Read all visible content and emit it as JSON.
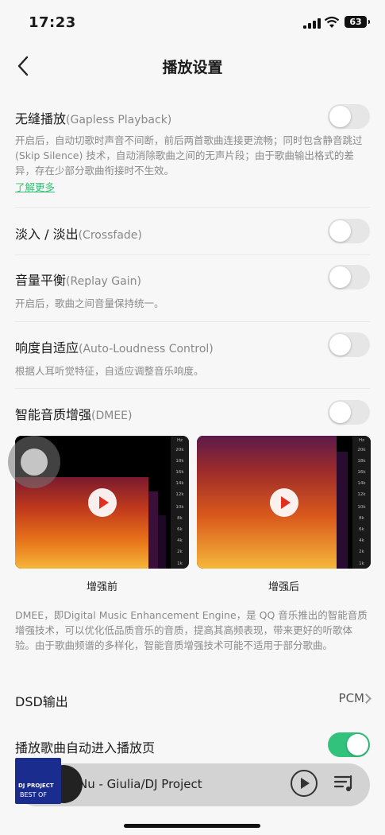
{
  "status": {
    "time": "17:23",
    "battery": "63"
  },
  "nav": {
    "title": "播放设置"
  },
  "settings": [
    {
      "title": "无缝播放",
      "en": "(Gapless Playback)",
      "desc": "开启后，自动切歌时声音不间断，前后两首歌曲连接更流畅；同时包含静音跳过 (Skip Silence) 技术，自动消除歌曲之间的无声片段；由于歌曲输出格式的差异，存在少部分歌曲衔接时不生效。",
      "link": "了解更多",
      "on": false
    },
    {
      "title": "淡入 / 淡出",
      "en": "(Crossfade)",
      "on": false
    },
    {
      "title": "音量平衡",
      "en": "(Replay Gain)",
      "desc": "开启后，歌曲之间音量保持统一。",
      "on": false
    },
    {
      "title": "响度自适应",
      "en": "(Auto-Loudness Control)",
      "desc": "根据人耳听觉特征，自适应调整音乐响度。",
      "on": false
    },
    {
      "title": "智能音质增强",
      "en": "(DMEE)",
      "on": false
    }
  ],
  "dmee": {
    "before_label": "增强前",
    "after_label": "增强后",
    "freq_ticks": [
      "Hz",
      "20k",
      "18k",
      "16k",
      "14k",
      "12k",
      "10k",
      "8k",
      "6k",
      "4k",
      "2k",
      "1k"
    ],
    "desc": "DMEE，即Digital Music Enhancement Engine，是 QQ 音乐推出的智能音质增强技术，可以优化低品质音乐的音质，提高其高频表现，带来更好的听歌体验。由于歌曲频谱的多样化，智能音质增强技术可能不适用于部分歌曲。"
  },
  "dsd": {
    "title": "DSD输出",
    "value": "PCM"
  },
  "autoplay": {
    "title": "播放歌曲自动进入播放页",
    "on": true
  },
  "player": {
    "song": "Nu - Giulia/DJ Project",
    "cover_line1": "DJ PROJECT",
    "cover_line2": "BEST OF"
  },
  "colors": {
    "accent": "#31c27c",
    "link": "#33c275"
  }
}
